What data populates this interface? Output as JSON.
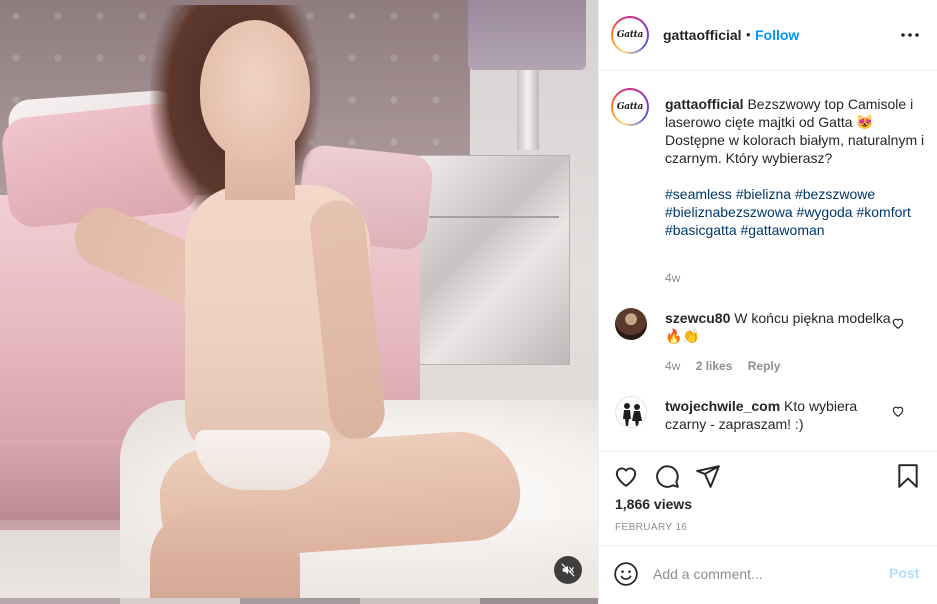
{
  "post": {
    "username": "gattaofficial",
    "separator": "•",
    "follow_label": "Follow",
    "avatar_logo_text": "Gatta"
  },
  "caption": {
    "username": "gattaofficial",
    "text": "Bezszwowy top Camisole i laserowo cięte majtki od Gatta 😻 Dostępne w kolorach białym, naturalnym i czarnym. Który wybierasz?",
    "hashtags": [
      "#seamless",
      "#bielizna",
      "#bezszwowe",
      "#bieliznabezszwowa",
      "#wygoda",
      "#komfort",
      "#basicgatta",
      "#gattawoman"
    ],
    "time": "4w"
  },
  "comments": [
    {
      "username": "szewcu80",
      "text": "W końcu piękna modelka 🔥👏",
      "time": "4w",
      "likes": "2 likes",
      "reply_label": "Reply"
    },
    {
      "username": "twojechwile_com",
      "text": "Kto wybiera czarny - zapraszam! :)"
    }
  ],
  "stats": {
    "views": "1,866 views",
    "date": "FEBRUARY 16"
  },
  "composer": {
    "placeholder": "Add a comment...",
    "post_label": "Post"
  },
  "colors": {
    "link_blue": "#0095f6",
    "hashtag_blue": "#00376b",
    "muted_gray": "#8e8e8e",
    "post_disabled": "#b2dffc"
  },
  "icons": {
    "more": "more-horizontal-icon",
    "like": "heart-icon",
    "comment": "comment-icon",
    "share": "paper-plane-icon",
    "save": "bookmark-icon",
    "emoji": "smiley-icon",
    "mute": "speaker-muted-icon"
  }
}
